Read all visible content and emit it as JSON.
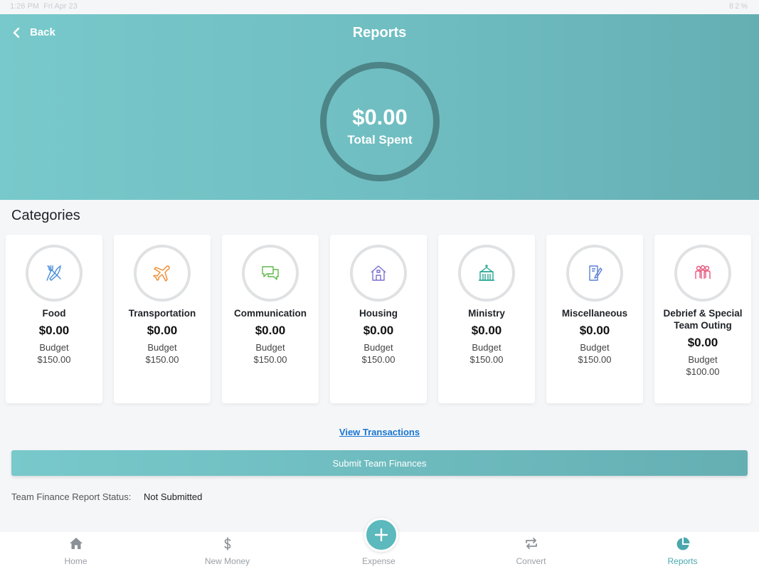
{
  "status_bar": {
    "time": "1:26 PM",
    "date": "Fri Apr 23",
    "battery": "82%"
  },
  "header": {
    "back_label": "Back",
    "title": "Reports",
    "total_amount": "$0.00",
    "total_label": "Total Spent"
  },
  "categories_heading": "Categories",
  "categories": [
    {
      "name": "Food",
      "spent": "$0.00",
      "budget_label": "Budget",
      "budget": "$150.00",
      "icon": "utensils-icon",
      "color": "#4a8fd8"
    },
    {
      "name": "Transportation",
      "spent": "$0.00",
      "budget_label": "Budget",
      "budget": "$150.00",
      "icon": "airplane-icon",
      "color": "#f08a2c"
    },
    {
      "name": "Communication",
      "spent": "$0.00",
      "budget_label": "Budget",
      "budget": "$150.00",
      "icon": "chat-icon",
      "color": "#5fb84a"
    },
    {
      "name": "Housing",
      "spent": "$0.00",
      "budget_label": "Budget",
      "budget": "$150.00",
      "icon": "house-icon",
      "color": "#7b6fd0"
    },
    {
      "name": "Ministry",
      "spent": "$0.00",
      "budget_label": "Budget",
      "budget": "$150.00",
      "icon": "church-icon",
      "color": "#26a694"
    },
    {
      "name": "Miscellaneous",
      "spent": "$0.00",
      "budget_label": "Budget",
      "budget": "$150.00",
      "icon": "document-pen-icon",
      "color": "#5b7fd6"
    },
    {
      "name": "Debrief & Special Team Outing",
      "spent": "$0.00",
      "budget_label": "Budget",
      "budget": "$100.00",
      "icon": "group-icon",
      "color": "#e5577d"
    }
  ],
  "view_transactions": "View Transactions",
  "submit_button": "Submit Team Finances",
  "report_status": {
    "label": "Team Finance Report Status:",
    "value": "Not Submitted"
  },
  "tabs": [
    {
      "label": "Home",
      "icon": "home-icon"
    },
    {
      "label": "New Money",
      "icon": "dollar-icon"
    },
    {
      "label": "Expense",
      "icon": "plus-icon"
    },
    {
      "label": "Convert",
      "icon": "convert-icon"
    },
    {
      "label": "Reports",
      "icon": "pie-chart-icon"
    }
  ],
  "accent_color": "#6fbdc1"
}
